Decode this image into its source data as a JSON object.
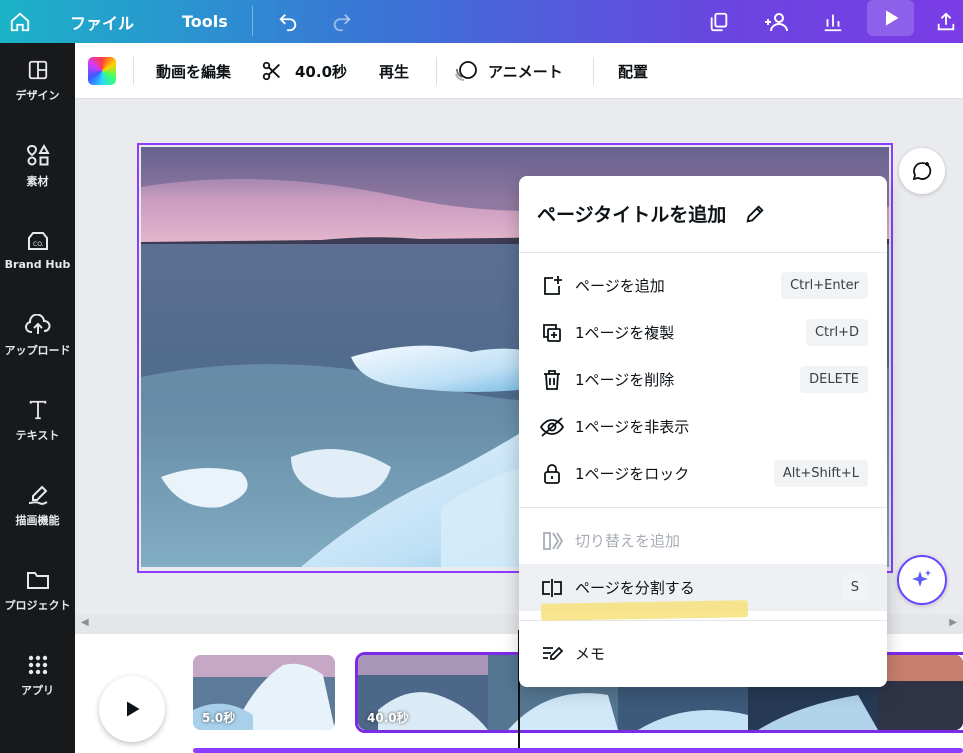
{
  "topbar": {
    "file_label": "ファイル",
    "tools_label": "Tools"
  },
  "sidebar": {
    "items": [
      {
        "label": "デザイン"
      },
      {
        "label": "素材"
      },
      {
        "label": "Brand Hub"
      },
      {
        "label": "アップロード"
      },
      {
        "label": "テキスト"
      },
      {
        "label": "描画機能"
      },
      {
        "label": "プロジェクト"
      },
      {
        "label": "アプリ"
      }
    ]
  },
  "toolbar": {
    "edit_video": "動画を編集",
    "duration": "40.0秒",
    "play": "再生",
    "animate": "アニメート",
    "arrange": "配置"
  },
  "context_menu": {
    "title": "ページタイトルを追加",
    "items": [
      {
        "label": "ページを追加",
        "shortcut": "Ctrl+Enter",
        "icon": "add-page-icon"
      },
      {
        "label": "1ページを複製",
        "shortcut": "Ctrl+D",
        "icon": "duplicate-icon"
      },
      {
        "label": "1ページを削除",
        "shortcut": "DELETE",
        "icon": "trash-icon"
      },
      {
        "label": "1ページを非表示",
        "shortcut": "",
        "icon": "eye-off-icon"
      },
      {
        "label": "1ページをロック",
        "shortcut": "Alt+Shift+L",
        "icon": "lock-icon"
      },
      {
        "label": "切り替えを追加",
        "shortcut": "",
        "icon": "transition-icon",
        "disabled": true
      },
      {
        "label": "ページを分割する",
        "shortcut": "S",
        "icon": "split-icon"
      },
      {
        "label": "メモ",
        "shortcut": "",
        "icon": "notes-icon"
      }
    ]
  },
  "timeline": {
    "clips": [
      {
        "duration": "5.0秒"
      },
      {
        "duration": "40.0秒"
      }
    ]
  },
  "colors": {
    "accent": "#8b3dff",
    "topbar_start": "#1bb3c8",
    "topbar_end": "#7a3ce6",
    "sidebar_bg": "#18191b",
    "highlight": "#f6e27a"
  }
}
